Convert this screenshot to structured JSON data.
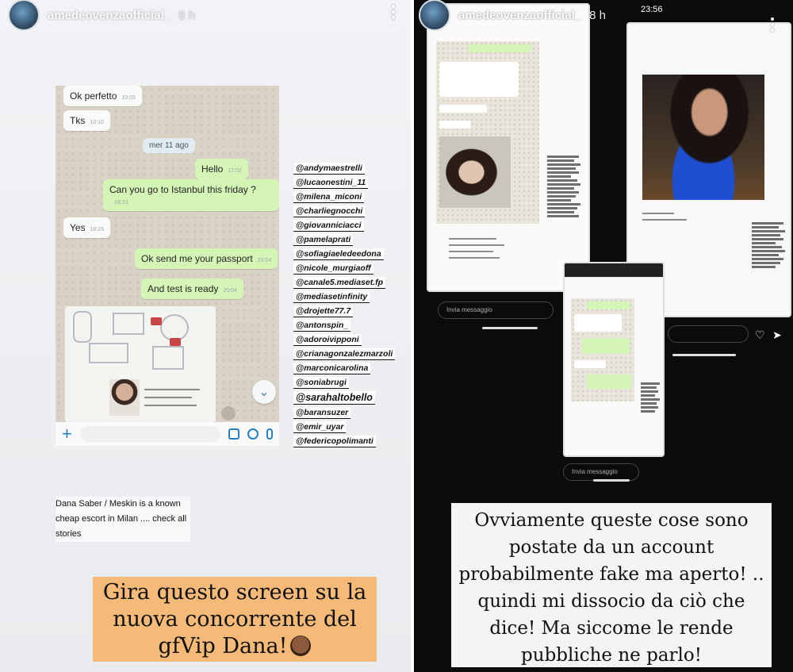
{
  "left_story": {
    "username": "amedeovenzaofficial_",
    "time": "8 h",
    "chat": {
      "messages": [
        {
          "text": "Ok perfetto",
          "time": "10:05",
          "dir": "in"
        },
        {
          "text": "Tks",
          "time": "10:10",
          "dir": "in"
        },
        {
          "text": "Hello",
          "time": "17:02",
          "dir": "out"
        },
        {
          "text": "Can you go to Istanbul this friday ?",
          "time": "18:23",
          "dir": "out"
        },
        {
          "text": "Yes",
          "time": "18:25",
          "dir": "in"
        },
        {
          "text": "Ok send me your passport",
          "time": "20:04",
          "dir": "out"
        },
        {
          "text": "And test is ready",
          "time": "20:04",
          "dir": "out"
        }
      ],
      "date_separator": "mer 11 ago"
    },
    "tags": [
      "@andymaestrelli",
      "@lucaonestini_11",
      "@milena_miconi",
      "@charliegnocchi",
      "@giovanniciacci",
      "@pamelaprati",
      "@sofiagiaeledeedona",
      "@nicole_murgiaoff",
      "@canale5.mediaset.fp",
      "@mediasetinfinity",
      "@drojette77.7",
      "@antonspin_",
      "@adoroivipponi",
      "@crianagonzalezmarzoli",
      "@marconicarolina",
      "@soniabrugi",
      "@sarahaltobello",
      "@baransuzer",
      "@emir_uyar",
      "@federicopolimanti"
    ],
    "note": "Dana Saber / Meskin is a known cheap escort in Milan .... check all stories",
    "caption": "Gira questo screen su la nuova concorrente del gfVip Dana!"
  },
  "right_story": {
    "username": "amedeovenzaofficial_",
    "time": "8 h",
    "status_time": "23:56",
    "send_placeholder_1": "Invia messaggio",
    "send_placeholder_2": "Invia messaggio",
    "caption": "Ovviamente queste cose sono postate da un account probabilmente fake ma aperto! .. quindi mi dissocio da ciò che dice! Ma siccome le rende pubbliche ne parlo!"
  }
}
